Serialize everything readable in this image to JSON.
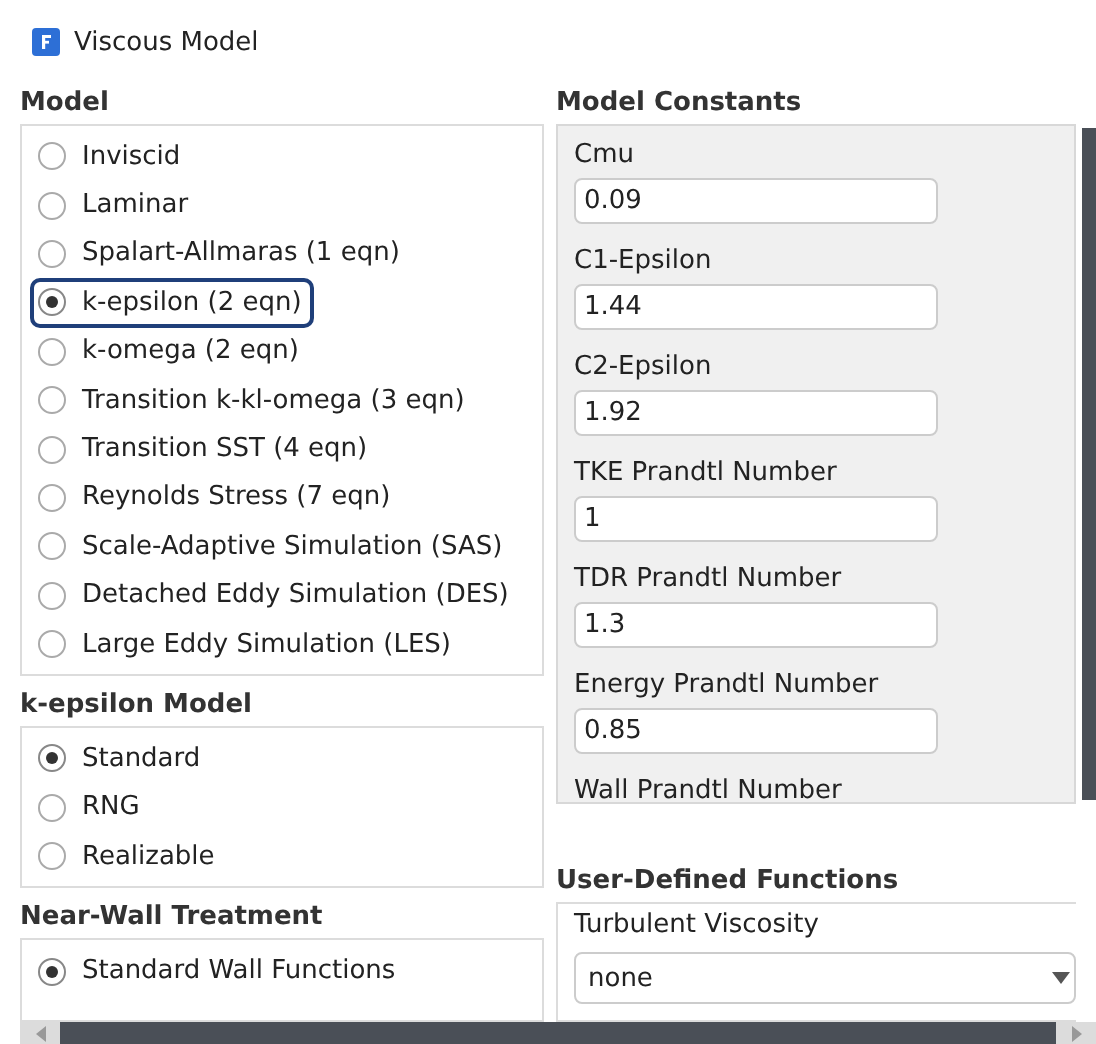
{
  "window": {
    "title": "Viscous Model"
  },
  "model": {
    "heading": "Model",
    "options": [
      {
        "label": "Inviscid",
        "selected": false,
        "highlighted": false
      },
      {
        "label": "Laminar",
        "selected": false,
        "highlighted": false
      },
      {
        "label": "Spalart-Allmaras (1 eqn)",
        "selected": false,
        "highlighted": false
      },
      {
        "label": "k-epsilon (2 eqn)",
        "selected": true,
        "highlighted": true
      },
      {
        "label": "k-omega (2 eqn)",
        "selected": false,
        "highlighted": false
      },
      {
        "label": "Transition k-kl-omega (3 eqn)",
        "selected": false,
        "highlighted": false
      },
      {
        "label": "Transition SST (4 eqn)",
        "selected": false,
        "highlighted": false
      },
      {
        "label": "Reynolds Stress (7 eqn)",
        "selected": false,
        "highlighted": false
      },
      {
        "label": "Scale-Adaptive Simulation (SAS)",
        "selected": false,
        "highlighted": false
      },
      {
        "label": "Detached Eddy Simulation (DES)",
        "selected": false,
        "highlighted": false
      },
      {
        "label": "Large Eddy Simulation (LES)",
        "selected": false,
        "highlighted": false
      }
    ]
  },
  "k_epsilon_model": {
    "heading": "k-epsilon Model",
    "options": [
      {
        "label": "Standard",
        "selected": true
      },
      {
        "label": "RNG",
        "selected": false
      },
      {
        "label": "Realizable",
        "selected": false
      }
    ]
  },
  "near_wall_treatment": {
    "heading": "Near-Wall Treatment",
    "options": [
      {
        "label": "Standard Wall Functions",
        "selected": true
      }
    ]
  },
  "model_constants": {
    "heading": "Model Constants",
    "fields": [
      {
        "label": "Cmu",
        "value": "0.09"
      },
      {
        "label": "C1-Epsilon",
        "value": "1.44"
      },
      {
        "label": "C2-Epsilon",
        "value": "1.92"
      },
      {
        "label": "TKE Prandtl Number",
        "value": "1"
      },
      {
        "label": "TDR Prandtl Number",
        "value": "1.3"
      },
      {
        "label": "Energy Prandtl Number",
        "value": "0.85"
      },
      {
        "label": "Wall Prandtl Number"
      }
    ]
  },
  "user_defined_functions": {
    "heading": "User-Defined Functions",
    "label": "Turbulent Viscosity",
    "value": "none"
  }
}
